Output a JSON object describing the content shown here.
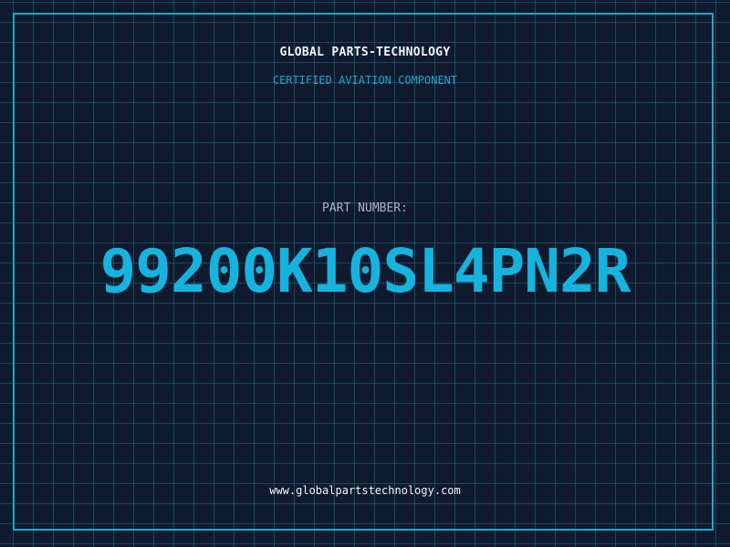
{
  "header": {
    "brand": "GLOBAL PARTS-TECHNOLOGY",
    "tagline": "CERTIFIED AVIATION COMPONENT"
  },
  "main": {
    "label": "PART NUMBER:",
    "part_number": "99200K10SL4PN2R"
  },
  "footer": {
    "url": "www.globalpartstechnology.com"
  },
  "colors": {
    "background": "#101a2e",
    "grid": "#266e80",
    "accent": "#16b3df",
    "frame": "#18a9cf",
    "text": "#f2f5f8",
    "label": "#aab4c2"
  }
}
